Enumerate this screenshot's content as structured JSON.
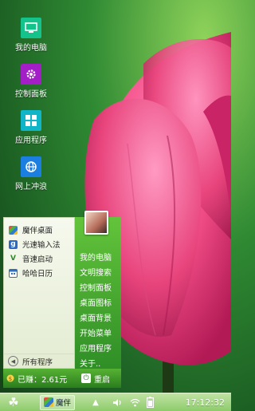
{
  "desktop": {
    "icons": [
      {
        "label": "我的电脑",
        "icon": "monitor-icon",
        "color": "#14c28c"
      },
      {
        "label": "控制面板",
        "icon": "gear-icon",
        "color": "#a31ec7"
      },
      {
        "label": "应用程序",
        "icon": "grid-icon",
        "color": "#10b5c8"
      },
      {
        "label": "网上冲浪",
        "icon": "globe-icon",
        "color": "#1a7fe0"
      }
    ]
  },
  "start_menu": {
    "apps": [
      {
        "label": "魔伴桌面",
        "icon": "pinwheel-icon"
      },
      {
        "label": "光速输入法",
        "icon": "g-icon"
      },
      {
        "label": "音速启动",
        "icon": "v-icon"
      },
      {
        "label": "哈哈日历",
        "icon": "calendar-icon"
      }
    ],
    "all_programs": "所有程序",
    "right_items": [
      "我的电脑",
      "文明搜索",
      "控制面板",
      "桌面图标",
      "桌面背景",
      "开始菜单",
      "应用程序",
      "关于.."
    ],
    "earn_label": "已赚：2.61元",
    "restart_label": "重启"
  },
  "taskbar": {
    "task_label": "魔伴",
    "clock": "17:12:32"
  }
}
